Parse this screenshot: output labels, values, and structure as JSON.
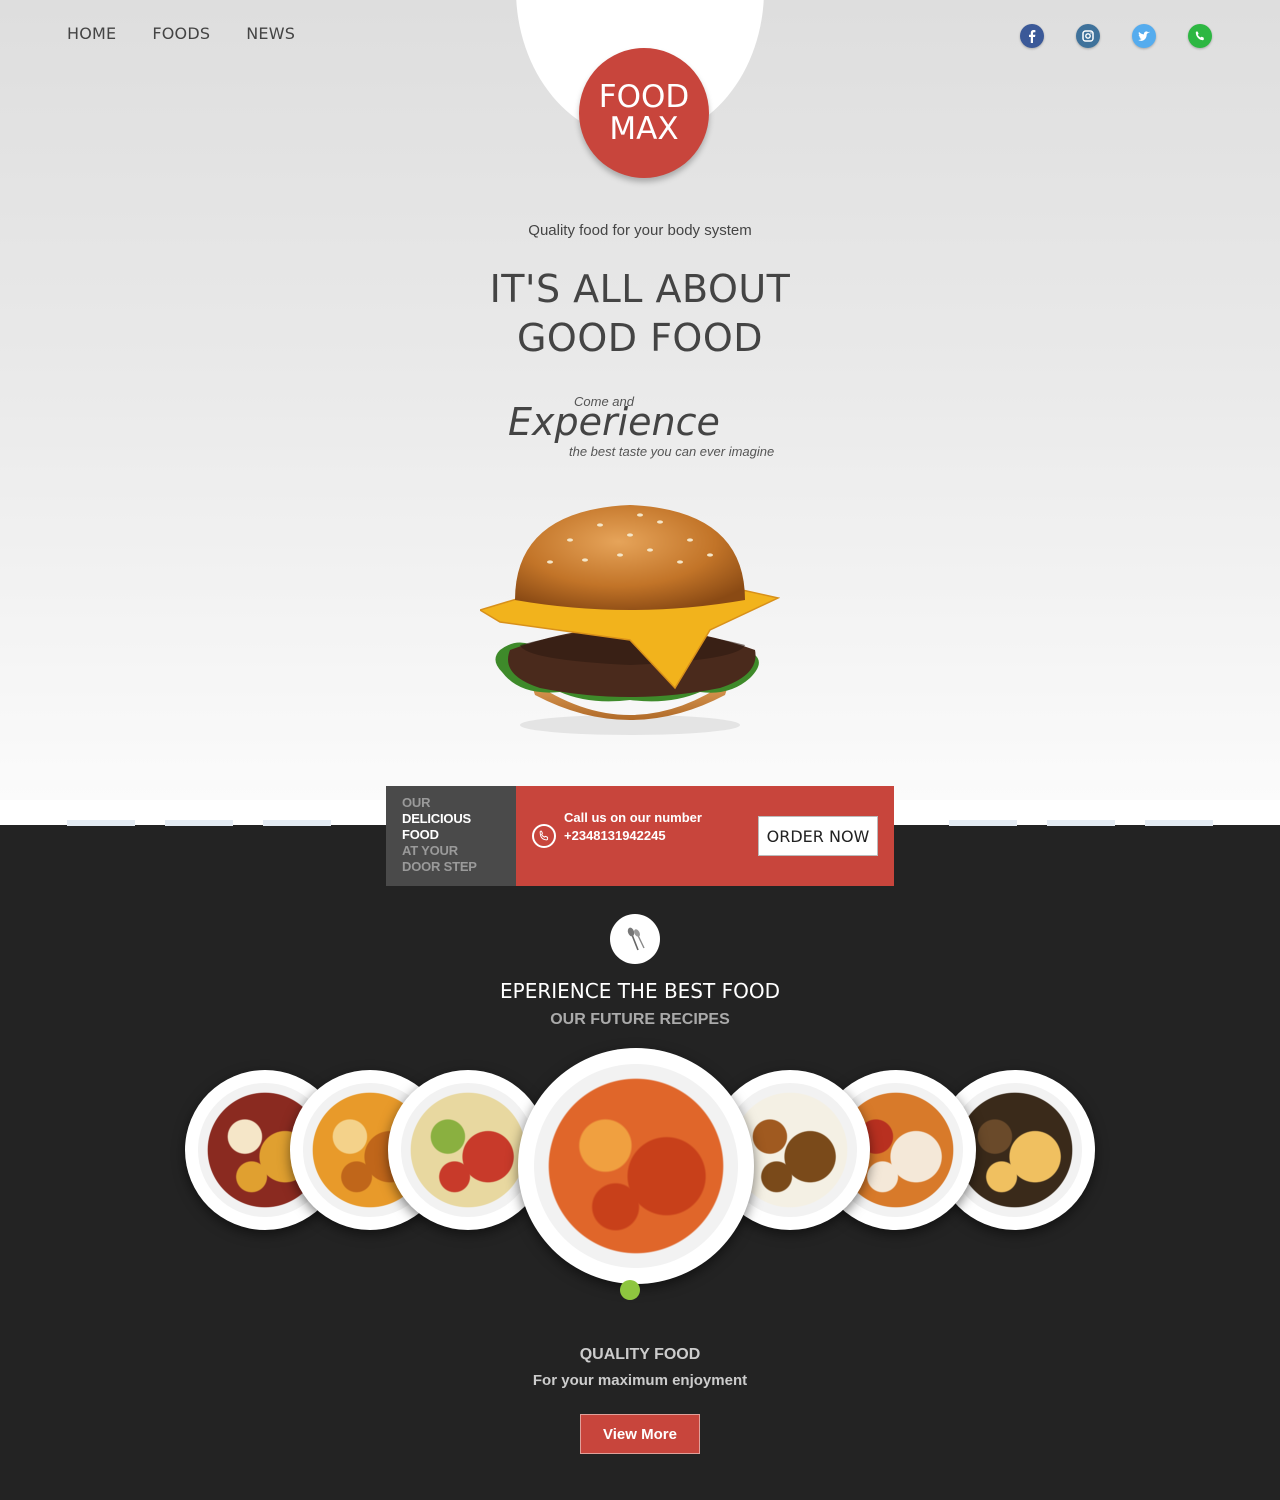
{
  "nav": {
    "items": [
      {
        "label": "HOME"
      },
      {
        "label": "FOODS"
      },
      {
        "label": "NEWS"
      }
    ]
  },
  "social": [
    {
      "icon": "facebook-icon",
      "color": "#3b5998"
    },
    {
      "icon": "instagram-icon",
      "color": "#3f729b"
    },
    {
      "icon": "twitter-icon",
      "color": "#55acee"
    },
    {
      "icon": "whatsapp-icon",
      "color": "#2db742"
    }
  ],
  "logo": {
    "line1": "FOOD",
    "line2": "MAX",
    "color": "#c8453c"
  },
  "hero": {
    "tagline": "Quality food for your body system",
    "headline_line1": "IT'S ALL ABOUT",
    "headline_line2": "GOOD FOOD",
    "come_and": "Come and",
    "experience": "Experience",
    "best_taste": "the best taste you can ever imagine"
  },
  "order": {
    "left_line1": "OUR",
    "left_line2": "DELICIOUS",
    "left_line3": "FOOD",
    "left_line4": "AT YOUR",
    "left_line5": "DOOR STEP",
    "call_label": "Call us on our number",
    "phone": "+2348131942245",
    "button": "ORDER NOW"
  },
  "recipes": {
    "title": "EPERIENCE THE BEST FOOD",
    "subtitle": "OUR FUTURE RECIPES",
    "plates": [
      {
        "name": "plate-1",
        "colors": [
          "#8a2a20",
          "#e0a030",
          "#f5e6c8"
        ]
      },
      {
        "name": "plate-2",
        "colors": [
          "#e89a2a",
          "#c0661a",
          "#f4d28a"
        ]
      },
      {
        "name": "plate-3",
        "colors": [
          "#e8d8a0",
          "#c83a2a",
          "#8ab040"
        ]
      },
      {
        "name": "plate-4",
        "colors": [
          "#e0662a",
          "#c8401a",
          "#f0a040"
        ]
      },
      {
        "name": "plate-5",
        "colors": [
          "#f4f0e4",
          "#7a4a1a",
          "#a05a20"
        ]
      },
      {
        "name": "plate-6",
        "colors": [
          "#d87a2a",
          "#f4e8d8",
          "#b83020"
        ]
      },
      {
        "name": "plate-7",
        "colors": [
          "#3a2a1a",
          "#f0c060",
          "#6a4a2a"
        ]
      }
    ],
    "active_dot_color": "#8ec63f"
  },
  "quality": {
    "title": "QUALITY FOOD",
    "subtitle": "For your maximum enjoyment",
    "button": "View More"
  }
}
